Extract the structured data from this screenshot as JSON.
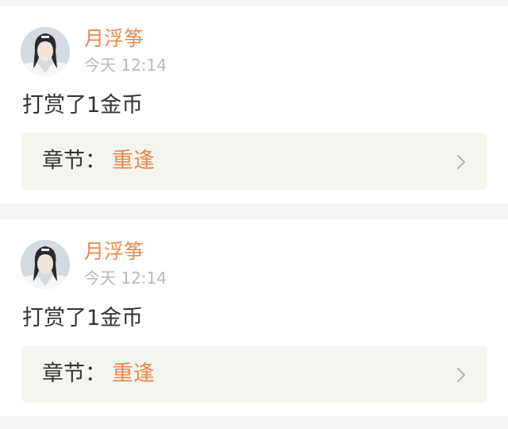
{
  "entries": [
    {
      "username": "月浮筝",
      "time": "今天 12:14",
      "action": "打赏了1金币",
      "chapter_label": "章节：",
      "chapter_title": "重逢",
      "avatar_icon": "user-avatar-icon"
    },
    {
      "username": "月浮筝",
      "time": "今天 12:14",
      "action": "打赏了1金币",
      "chapter_label": "章节：",
      "chapter_title": "重逢",
      "avatar_icon": "user-avatar-icon"
    }
  ],
  "colors": {
    "accent": "#e8894f",
    "text": "#333333",
    "muted": "#b8b8b8",
    "chapter_bg": "#f5f5ef",
    "page_bg": "#f4f4f4"
  }
}
